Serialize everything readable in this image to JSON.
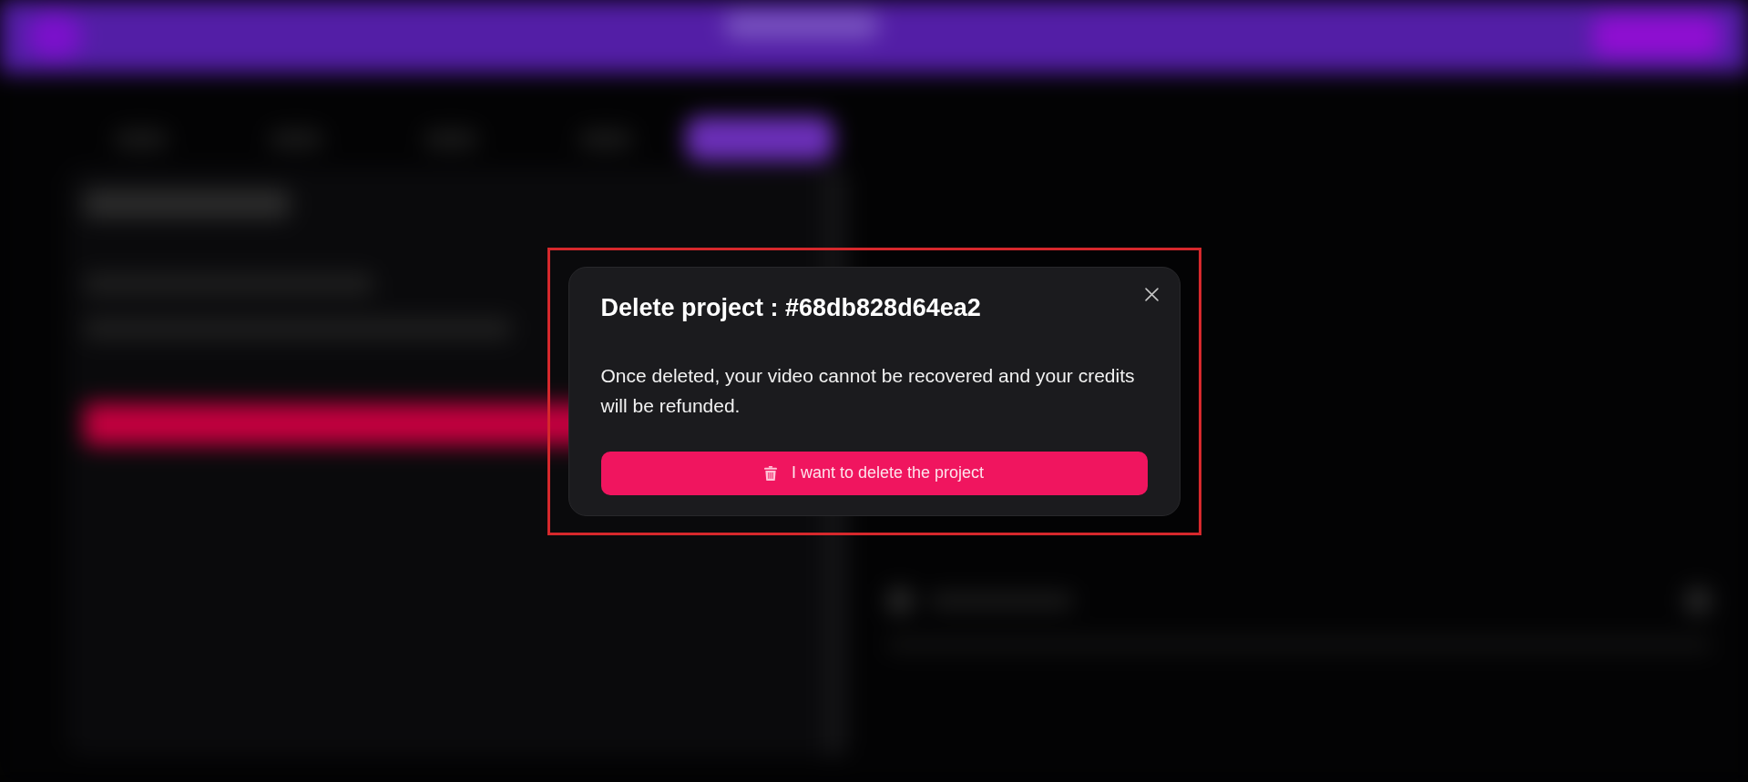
{
  "dialog": {
    "title": "Delete project : #68db828d64ea2",
    "message": "Once deleted, your video cannot be recovered and your credits will be refunded.",
    "confirm_button": {
      "label": "I want to delete the project"
    }
  }
}
